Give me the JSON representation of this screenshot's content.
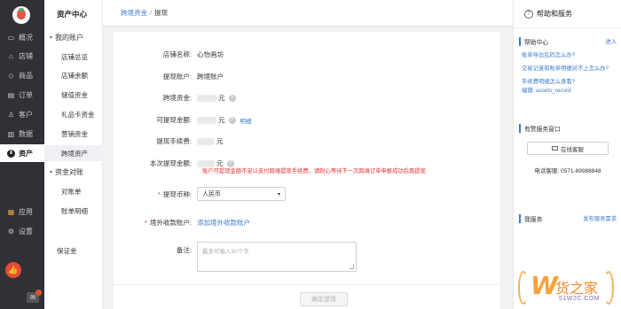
{
  "nav": {
    "items": [
      {
        "icon": "monitor-icon",
        "glyph": "▭",
        "label": "概况"
      },
      {
        "icon": "store-icon",
        "glyph": "⌂",
        "label": "店铺"
      },
      {
        "icon": "tag-icon",
        "glyph": "◇",
        "label": "商品"
      },
      {
        "icon": "order-icon",
        "glyph": "▤",
        "label": "订单"
      },
      {
        "icon": "user-icon",
        "glyph": "♙",
        "label": "客户"
      },
      {
        "icon": "chart-icon",
        "glyph": "▥",
        "label": "数据"
      },
      {
        "icon": "yen-icon",
        "glyph": "¥",
        "label": "资产"
      },
      {
        "icon": "apps-icon",
        "glyph": "▦",
        "label": "应用"
      },
      {
        "icon": "settings-icon",
        "glyph": "⚙",
        "label": "设置"
      }
    ],
    "active": "资产"
  },
  "side": {
    "title": "资产中心",
    "groups": [
      {
        "label": "我的账户",
        "items": [
          "店铺总览",
          "店铺余额",
          "储值资金",
          "礼品卡资金",
          "营销资金",
          "跨境资产"
        ]
      },
      {
        "label": "资金对账",
        "items": [
          "对账单",
          "账单明细"
        ]
      }
    ],
    "extra": "保证金",
    "active_item": "跨境资产"
  },
  "breadcrumb": {
    "parent": "跨境资金",
    "sep": "/",
    "current": "提现"
  },
  "form": {
    "store_name": {
      "label": "店铺名称:",
      "value": "心怡画坊"
    },
    "withdraw_account": {
      "label": "提现账户:",
      "value": "跨境账户"
    },
    "cross_funds": {
      "label": "跨境资金:",
      "unit": "元"
    },
    "withdrawable": {
      "label": "可提现金额:",
      "unit": "元",
      "link": "明细"
    },
    "fee": {
      "label": "提现手续费:",
      "unit": "元"
    },
    "amount": {
      "label": "本次提现金额:",
      "unit": "元"
    },
    "warning": "账户可提现金额不足以支付跨境提现手续费，请耐心等待下一次跨境订单申报成功后再提现",
    "currency": {
      "label": "提现币种:",
      "value": "人民币"
    },
    "overseas_account": {
      "label": "境外收款账户:",
      "link": "添加境外收款账户"
    },
    "remark": {
      "label": "备注:",
      "placeholder": "最多可输入50个字"
    },
    "submit": "确定提现"
  },
  "right": {
    "title": "帮助和服务",
    "help_center": {
      "title": "帮助中心",
      "more": "进入",
      "questions": [
        "账单导出乱码怎么办?",
        "交易记录和账单明细对不上怎么办?",
        "手续费明细怎么查看?"
      ],
      "tag": "编辑: assets_record"
    },
    "service": {
      "title": "有赞服务窗口",
      "button": "在线客服",
      "phone": "电话客服:  0571-89988848"
    },
    "my_service": {
      "title": "我服务",
      "more": "发布服务需求"
    }
  },
  "watermark": {
    "mark": "W",
    "name": "货之家",
    "domain": "51W2C.COM"
  },
  "badges": {
    "notify": "👍",
    "chat": "✉"
  }
}
